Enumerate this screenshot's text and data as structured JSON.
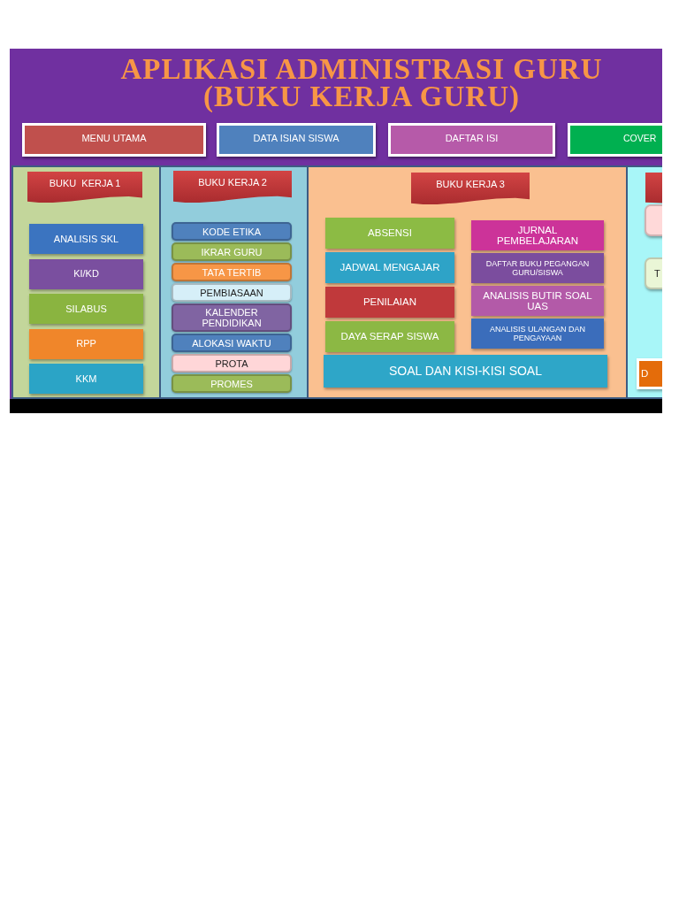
{
  "title": {
    "lines": [
      "APLIKASI ADMINISTRASI GURU",
      "(BUKU KERJA GURU)"
    ]
  },
  "nav_buttons": [
    {
      "label": "MENU UTAMA",
      "color": "#c0504d"
    },
    {
      "label": "DATA ISIAN SISWA",
      "color": "#4f81bd"
    },
    {
      "label": "DAFTAR ISI",
      "color": "#b65aa9"
    },
    {
      "label": "COVER",
      "color": "#00b050"
    }
  ],
  "columns": [
    {
      "kind": "stack",
      "color": "#c3d69b",
      "heading": "BUKU  KERJA 1",
      "items": [
        {
          "label": "ANALISIS SKL",
          "color": "#3b74c0"
        },
        {
          "label": "KI/KD",
          "color": "#7a4f9f"
        },
        {
          "label": "SILABUS",
          "color": "#8ab440"
        },
        {
          "label": "RPP",
          "color": "#f0862a"
        },
        {
          "label": "KKM",
          "color": "#2ba4c6"
        }
      ]
    },
    {
      "kind": "pills",
      "color": "#92cddc",
      "heading": "BUKU KERJA 2",
      "items": [
        {
          "label": "KODE ETIKA",
          "color": "#4f81bd"
        },
        {
          "label": "IKRAR GURU",
          "color": "#9bbb59"
        },
        {
          "label": "TATA TERTIB",
          "color": "#f79646"
        },
        {
          "label": "PEMBIASAAN",
          "color": "#d6eff8"
        },
        {
          "label": "KALENDER PENDIDIKAN",
          "color": "#8064a2"
        },
        {
          "label": "ALOKASI WAKTU",
          "color": "#4f81bd"
        },
        {
          "label": "PROTA",
          "color": "#ffd6d8"
        },
        {
          "label": "PROMES",
          "color": "#9bbb59"
        }
      ]
    },
    {
      "kind": "split",
      "color": "#fac090",
      "heading": "BUKU KERJA 3",
      "left_items": [
        {
          "label": "ABSENSI",
          "color": "#8cbb44"
        },
        {
          "label": "JADWAL MENGAJAR",
          "color": "#2ea3c7"
        },
        {
          "label": "PENILAIAN",
          "color": "#c0393b"
        },
        {
          "label": "DAYA SERAP SISWA",
          "color": "#8cb844"
        }
      ],
      "right_items": [
        {
          "label": "JURNAL PEMBELAJARAN",
          "color": "#cc3399"
        },
        {
          "label": "DAFTAR BUKU PEGANGAN GURU/SISWA",
          "color": "#7b4d9e"
        },
        {
          "label": "ANALISIS BUTIR SOAL UAS",
          "color": "#b35aa8"
        },
        {
          "label": "ANALISIS ULANGAN DAN PENGAYAAN",
          "color": "#3b6dbb"
        }
      ],
      "wide_item": {
        "label": "SOAL DAN KISI-KISI SOAL",
        "color": "#2ea6c8"
      }
    },
    {
      "kind": "partial",
      "color": "#a8f6f8",
      "items": [
        {
          "kind": "pill",
          "color": "#ffd9d9"
        },
        {
          "kind": "pill",
          "label": "T",
          "color": "#eaf6d6"
        },
        {
          "kind": "framed",
          "label": "D",
          "color": "#e46c0a"
        }
      ]
    }
  ]
}
